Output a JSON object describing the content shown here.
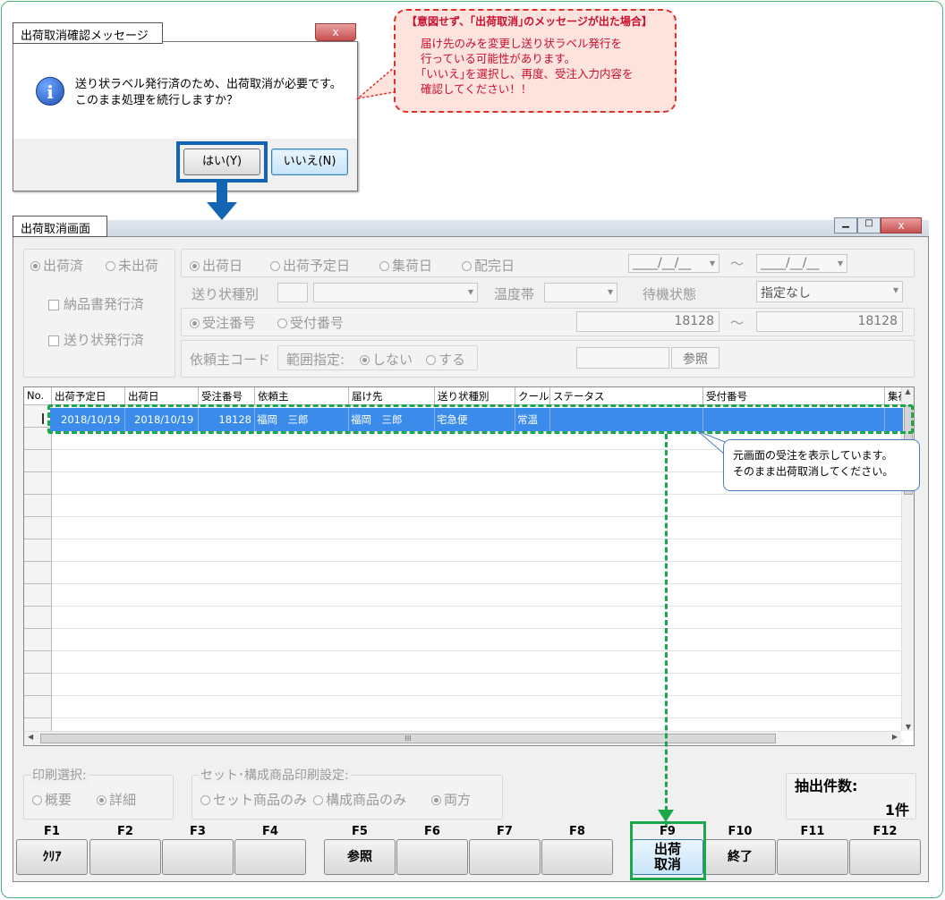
{
  "dialog": {
    "title": "出荷取消確認メッセージ",
    "close": "x",
    "message_line1": "送り状ラベル発行済のため、出荷取消が必要です。",
    "message_line2": "このまま処理を続行しますか？",
    "yes_button": "はい(Y)",
    "no_button": "いいえ(N)"
  },
  "callout": {
    "title": "【意図せず、｢出荷取消｣のメッセージが出た場合】",
    "line1": "届け先のみを変更し送り状ラベル発行を",
    "line2": "行っている可能性があります。",
    "line3": "｢いいえ｣を選択し、再度、受注入力内容を",
    "line4": "確認してください！！"
  },
  "main": {
    "title": "出荷取消画面",
    "filters": {
      "shipped": "出荷済",
      "unshipped": "未出荷",
      "delivery_note_issued": "納品書発行済",
      "waybill_issued": "送り状発行済",
      "date_ship": "出荷日",
      "date_planned": "出荷予定日",
      "date_collect": "集荷日",
      "date_delivered": "配完日",
      "date_from": "____/__/__",
      "date_to": "____/__/__",
      "tilde": "〜",
      "waybill_type_label": "送り状種別",
      "temp_zone_label": "温度帯",
      "wait_status_label": "待機状態",
      "wait_status_value": "指定なし",
      "order_no": "受注番号",
      "receipt_no": "受付番号",
      "num_from": "18128",
      "num_to": "18128",
      "client_code_label": "依頼主コード",
      "range_label": "範囲指定:",
      "range_no": "しない",
      "range_yes": "する",
      "ref_button": "参照"
    },
    "grid": {
      "columns": [
        "No.",
        "出荷予定日",
        "出荷日",
        "受注番号",
        "依頼主",
        "届け先",
        "送り状種別",
        "クール",
        "ステータス",
        "受付番号",
        "集荷"
      ],
      "row": [
        "2018/10/19",
        "2018/10/19",
        "18128",
        "福岡　三郎",
        "福岡　三郎",
        "宅急便",
        "常温",
        "",
        ""
      ],
      "scroll_mark": "III"
    },
    "tooltip": {
      "line1": "元画面の受注を表示しています。",
      "line2": "そのまま出荷取消してください。"
    },
    "print": {
      "label": "印刷選択:",
      "summary": "概要",
      "detail": "詳細",
      "set_label": "セット･構成商品印刷設定:",
      "set_only": "セット商品のみ",
      "component_only": "構成商品のみ",
      "both": "両方"
    },
    "count": {
      "label": "抽出件数:",
      "value": "1件"
    },
    "fkeys": [
      {
        "key": "F1",
        "label": "ｸﾘｱ"
      },
      {
        "key": "F2",
        "label": ""
      },
      {
        "key": "F3",
        "label": ""
      },
      {
        "key": "F4",
        "label": ""
      },
      {
        "key": "F5",
        "label": "参照"
      },
      {
        "key": "F6",
        "label": ""
      },
      {
        "key": "F7",
        "label": ""
      },
      {
        "key": "F8",
        "label": ""
      },
      {
        "key": "F9",
        "label": "出荷取消"
      },
      {
        "key": "F10",
        "label": "終了"
      },
      {
        "key": "F11",
        "label": ""
      },
      {
        "key": "F12",
        "label": ""
      }
    ]
  }
}
